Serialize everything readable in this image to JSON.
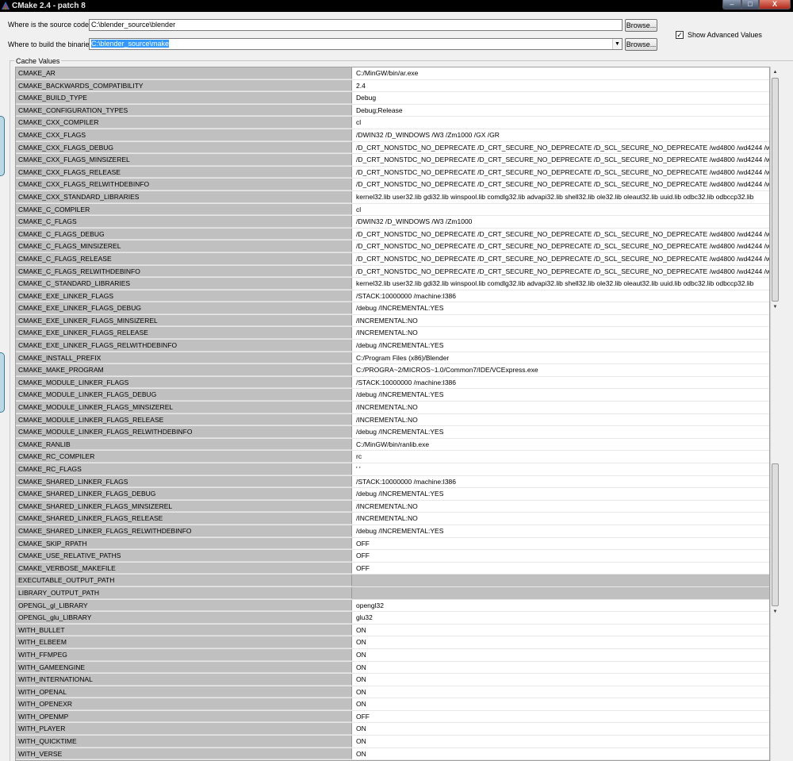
{
  "window": {
    "title": "CMake 2.4 - patch 8",
    "min_label": "–",
    "max_label": "□",
    "close_label": "X"
  },
  "source": {
    "label": "Where is the source code:",
    "value": "C:\\blender_source\\blender",
    "browse": "Browse..."
  },
  "build": {
    "label": "Where to build the binaries:",
    "value": "C:\\blender_source\\make",
    "browse": "Browse..."
  },
  "advanced": {
    "label": "Show Advanced Values",
    "checked": true,
    "mark": "✓"
  },
  "cache": {
    "title": "Cache Values",
    "rows": [
      {
        "key": "CMAKE_AR",
        "value": "C:/MinGW/bin/ar.exe"
      },
      {
        "key": "CMAKE_BACKWARDS_COMPATIBILITY",
        "value": "2.4"
      },
      {
        "key": "CMAKE_BUILD_TYPE",
        "value": "Debug"
      },
      {
        "key": "CMAKE_CONFIGURATION_TYPES",
        "value": "Debug;Release"
      },
      {
        "key": "CMAKE_CXX_COMPILER",
        "value": "cl"
      },
      {
        "key": "CMAKE_CXX_FLAGS",
        "value": " /DWIN32 /D_WINDOWS /W3 /Zm1000 /GX /GR"
      },
      {
        "key": "CMAKE_CXX_FLAGS_DEBUG",
        "value": "/D_CRT_NONSTDC_NO_DEPRECATE /D_CRT_SECURE_NO_DEPRECATE /D_SCL_SECURE_NO_DEPRECATE /wd4800 /wd4244 /w"
      },
      {
        "key": "CMAKE_CXX_FLAGS_MINSIZEREL",
        "value": "/D_CRT_NONSTDC_NO_DEPRECATE /D_CRT_SECURE_NO_DEPRECATE /D_SCL_SECURE_NO_DEPRECATE /wd4800 /wd4244 /w"
      },
      {
        "key": "CMAKE_CXX_FLAGS_RELEASE",
        "value": "/D_CRT_NONSTDC_NO_DEPRECATE /D_CRT_SECURE_NO_DEPRECATE /D_SCL_SECURE_NO_DEPRECATE /wd4800 /wd4244 /w"
      },
      {
        "key": "CMAKE_CXX_FLAGS_RELWITHDEBINFO",
        "value": "/D_CRT_NONSTDC_NO_DEPRECATE /D_CRT_SECURE_NO_DEPRECATE /D_SCL_SECURE_NO_DEPRECATE /wd4800 /wd4244 /w"
      },
      {
        "key": "CMAKE_CXX_STANDARD_LIBRARIES",
        "value": "kernel32.lib user32.lib gdi32.lib winspool.lib comdlg32.lib advapi32.lib shell32.lib ole32.lib oleaut32.lib uuid.lib odbc32.lib odbccp32.lib"
      },
      {
        "key": "CMAKE_C_COMPILER",
        "value": "cl"
      },
      {
        "key": "CMAKE_C_FLAGS",
        "value": " /DWIN32 /D_WINDOWS /W3 /Zm1000"
      },
      {
        "key": "CMAKE_C_FLAGS_DEBUG",
        "value": "/D_CRT_NONSTDC_NO_DEPRECATE /D_CRT_SECURE_NO_DEPRECATE /D_SCL_SECURE_NO_DEPRECATE /wd4800 /wd4244 /w"
      },
      {
        "key": "CMAKE_C_FLAGS_MINSIZEREL",
        "value": "/D_CRT_NONSTDC_NO_DEPRECATE /D_CRT_SECURE_NO_DEPRECATE /D_SCL_SECURE_NO_DEPRECATE /wd4800 /wd4244 /w"
      },
      {
        "key": "CMAKE_C_FLAGS_RELEASE",
        "value": "/D_CRT_NONSTDC_NO_DEPRECATE /D_CRT_SECURE_NO_DEPRECATE /D_SCL_SECURE_NO_DEPRECATE /wd4800 /wd4244 /w"
      },
      {
        "key": "CMAKE_C_FLAGS_RELWITHDEBINFO",
        "value": "/D_CRT_NONSTDC_NO_DEPRECATE /D_CRT_SECURE_NO_DEPRECATE /D_SCL_SECURE_NO_DEPRECATE /wd4800 /wd4244 /w"
      },
      {
        "key": "CMAKE_C_STANDARD_LIBRARIES",
        "value": "kernel32.lib user32.lib gdi32.lib winspool.lib comdlg32.lib advapi32.lib shell32.lib ole32.lib oleaut32.lib uuid.lib odbc32.lib odbccp32.lib"
      },
      {
        "key": "CMAKE_EXE_LINKER_FLAGS",
        "value": " /STACK:10000000 /machine:I386"
      },
      {
        "key": "CMAKE_EXE_LINKER_FLAGS_DEBUG",
        "value": "/debug /INCREMENTAL:YES"
      },
      {
        "key": "CMAKE_EXE_LINKER_FLAGS_MINSIZEREL",
        "value": "/INCREMENTAL:NO"
      },
      {
        "key": "CMAKE_EXE_LINKER_FLAGS_RELEASE",
        "value": "/INCREMENTAL:NO"
      },
      {
        "key": "CMAKE_EXE_LINKER_FLAGS_RELWITHDEBINFO",
        "value": "/debug /INCREMENTAL:YES"
      },
      {
        "key": "CMAKE_INSTALL_PREFIX",
        "value": "C:/Program Files (x86)/Blender"
      },
      {
        "key": "CMAKE_MAKE_PROGRAM",
        "value": "C:/PROGRA~2/MICROS~1.0/Common7/IDE/VCExpress.exe"
      },
      {
        "key": "CMAKE_MODULE_LINKER_FLAGS",
        "value": " /STACK:10000000 /machine:I386"
      },
      {
        "key": "CMAKE_MODULE_LINKER_FLAGS_DEBUG",
        "value": "/debug /INCREMENTAL:YES"
      },
      {
        "key": "CMAKE_MODULE_LINKER_FLAGS_MINSIZEREL",
        "value": "/INCREMENTAL:NO"
      },
      {
        "key": "CMAKE_MODULE_LINKER_FLAGS_RELEASE",
        "value": "/INCREMENTAL:NO"
      },
      {
        "key": "CMAKE_MODULE_LINKER_FLAGS_RELWITHDEBINFO",
        "value": "/debug /INCREMENTAL:YES"
      },
      {
        "key": "CMAKE_RANLIB",
        "value": "C:/MinGW/bin/ranlib.exe"
      },
      {
        "key": "CMAKE_RC_COMPILER",
        "value": "rc"
      },
      {
        "key": "CMAKE_RC_FLAGS",
        "value": "' '"
      },
      {
        "key": "CMAKE_SHARED_LINKER_FLAGS",
        "value": " /STACK:10000000 /machine:I386"
      },
      {
        "key": "CMAKE_SHARED_LINKER_FLAGS_DEBUG",
        "value": "/debug /INCREMENTAL:YES"
      },
      {
        "key": "CMAKE_SHARED_LINKER_FLAGS_MINSIZEREL",
        "value": "/INCREMENTAL:NO"
      },
      {
        "key": "CMAKE_SHARED_LINKER_FLAGS_RELEASE",
        "value": "/INCREMENTAL:NO"
      },
      {
        "key": "CMAKE_SHARED_LINKER_FLAGS_RELWITHDEBINFO",
        "value": "/debug /INCREMENTAL:YES"
      },
      {
        "key": "CMAKE_SKIP_RPATH",
        "value": "OFF"
      },
      {
        "key": "CMAKE_USE_RELATIVE_PATHS",
        "value": "OFF"
      },
      {
        "key": "CMAKE_VERBOSE_MAKEFILE",
        "value": "OFF"
      },
      {
        "key": "EXECUTABLE_OUTPUT_PATH",
        "value": ""
      },
      {
        "key": "LIBRARY_OUTPUT_PATH",
        "value": ""
      },
      {
        "key": "OPENGL_gl_LIBRARY",
        "value": "opengl32"
      },
      {
        "key": "OPENGL_glu_LIBRARY",
        "value": "glu32"
      },
      {
        "key": "WITH_BULLET",
        "value": "ON"
      },
      {
        "key": "WITH_ELBEEM",
        "value": "ON"
      },
      {
        "key": "WITH_FFMPEG",
        "value": "ON"
      },
      {
        "key": "WITH_GAMEENGINE",
        "value": "ON"
      },
      {
        "key": "WITH_INTERNATIONAL",
        "value": "ON"
      },
      {
        "key": "WITH_OPENAL",
        "value": "ON"
      },
      {
        "key": "WITH_OPENEXR",
        "value": "ON"
      },
      {
        "key": "WITH_OPENMP",
        "value": "OFF"
      },
      {
        "key": "WITH_PLAYER",
        "value": "ON"
      },
      {
        "key": "WITH_QUICKTIME",
        "value": "ON"
      },
      {
        "key": "WITH_VERSE",
        "value": "ON"
      }
    ]
  },
  "scrollbar": {
    "up": "▲",
    "down": "▼"
  }
}
